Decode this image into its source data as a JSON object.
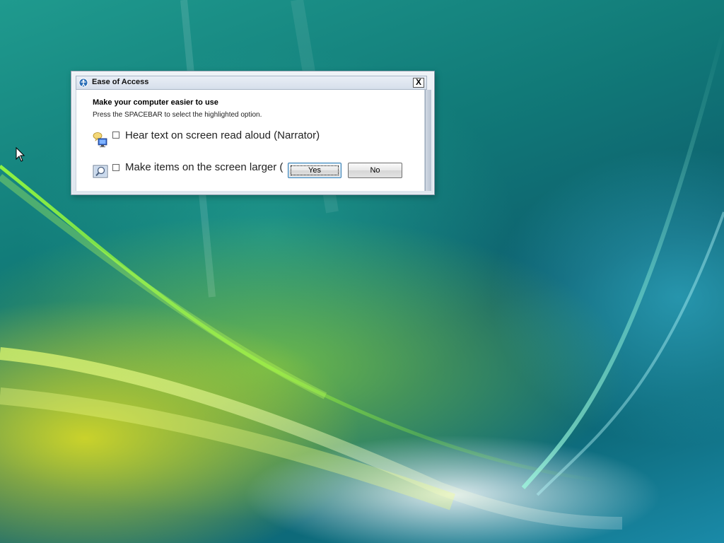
{
  "desktop": {
    "wallpaper_name": "windows-vista-aurora-wallpaper"
  },
  "dialog": {
    "title": "Ease of Access",
    "title_icon": "ease-of-access-icon",
    "close_label": "X",
    "heading": "Make your computer easier to use",
    "instruction": "Press the SPACEBAR to select the highlighted option.",
    "options": [
      {
        "label": "Hear text on screen read aloud (Narrator)",
        "icon": "narrator-icon",
        "checked": false
      },
      {
        "label": "Make items on the screen larger (",
        "icon": "magnifier-icon",
        "checked": false
      }
    ],
    "buttons": {
      "yes": "Yes",
      "no": "No"
    }
  },
  "colors": {
    "dialog_bg": "#ffffff",
    "titlebar": "#dfe6ee",
    "default_button_border": "#3c7fb1"
  }
}
